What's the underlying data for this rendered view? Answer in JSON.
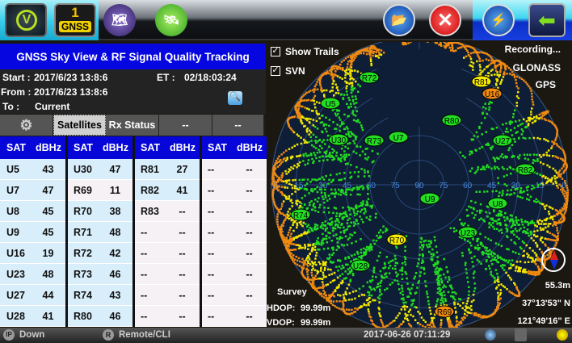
{
  "toolbar": {
    "gnss_count": "1",
    "gnss_label": "GNSS",
    "icons": [
      "viavi-home-icon",
      "gnss-badge-icon",
      "map-lock-icon",
      "satellite-lock-icon",
      "folder-usb-icon",
      "close-icon",
      "power-plug-icon",
      "back-arrow-icon"
    ]
  },
  "title": "GNSS Sky View & RF Signal Quality Tracking",
  "info": {
    "start_label": "Start :",
    "start": "2017/6/23 13:8:6",
    "et_label": "ET :",
    "et": "02/18:03:24",
    "from_label": "From :",
    "from": "2017/6/23 13:8:6",
    "to_label": "To :",
    "to": "Current"
  },
  "tabs": [
    {
      "label": "Satellites",
      "active": true
    },
    {
      "label": "Rx Status"
    },
    {
      "label": "--"
    },
    {
      "label": "--"
    }
  ],
  "table": {
    "headers": [
      "SAT",
      "dBHz"
    ],
    "groups": [
      [
        [
          "U5",
          "43",
          1
        ],
        [
          "U7",
          "47",
          1
        ],
        [
          "U8",
          "45",
          1
        ],
        [
          "U9",
          "45",
          1
        ],
        [
          "U16",
          "19",
          1
        ],
        [
          "U23",
          "48",
          1
        ],
        [
          "U27",
          "44",
          1
        ],
        [
          "U28",
          "41",
          1
        ]
      ],
      [
        [
          "U30",
          "47",
          1
        ],
        [
          "R69",
          "11",
          0
        ],
        [
          "R70",
          "38",
          1
        ],
        [
          "R71",
          "48",
          1
        ],
        [
          "R72",
          "42",
          1
        ],
        [
          "R73",
          "46",
          1
        ],
        [
          "R74",
          "43",
          1
        ],
        [
          "R80",
          "46",
          1
        ]
      ],
      [
        [
          "R81",
          "27",
          1
        ],
        [
          "R82",
          "41",
          1
        ],
        [
          "R83",
          "--",
          0
        ],
        [
          "--",
          "--",
          0
        ],
        [
          "--",
          "--",
          0
        ],
        [
          "--",
          "--",
          0
        ],
        [
          "--",
          "--",
          0
        ],
        [
          "--",
          "--",
          0
        ]
      ],
      [
        [
          "--",
          "--",
          0
        ],
        [
          "--",
          "--",
          0
        ],
        [
          "--",
          "--",
          0
        ],
        [
          "--",
          "--",
          0
        ],
        [
          "--",
          "--",
          0
        ],
        [
          "--",
          "--",
          0
        ],
        [
          "--",
          "--",
          0
        ],
        [
          "--",
          "--",
          0
        ]
      ]
    ]
  },
  "skyview": {
    "show_trails": {
      "label": "Show Trails",
      "checked": true
    },
    "svn": {
      "label": "SVN",
      "checked": true
    },
    "recording": "Recording...",
    "constellations": [
      "GLONASS",
      "GPS"
    ],
    "elevation_ticks": [
      "0",
      "15",
      "30",
      "45",
      "60",
      "75",
      "90",
      "75",
      "60",
      "45",
      "30",
      "15",
      "0"
    ],
    "satellites": [
      {
        "id": "R72",
        "color": "#22dd22"
      },
      {
        "id": "R81",
        "color": "#f4e800"
      },
      {
        "id": "U16",
        "color": "#f08a10"
      },
      {
        "id": "U5",
        "color": "#22dd22"
      },
      {
        "id": "R80",
        "color": "#22dd22"
      },
      {
        "id": "U7",
        "color": "#22dd22"
      },
      {
        "id": "U27",
        "color": "#22dd22"
      },
      {
        "id": "U30",
        "color": "#22dd22"
      },
      {
        "id": "R73",
        "color": "#22dd22"
      },
      {
        "id": "R82",
        "color": "#22dd22"
      },
      {
        "id": "U9",
        "color": "#22dd22"
      },
      {
        "id": "U8",
        "color": "#22dd22"
      },
      {
        "id": "R74",
        "color": "#22dd22"
      },
      {
        "id": "R70",
        "color": "#f4e800"
      },
      {
        "id": "U23",
        "color": "#22dd22"
      },
      {
        "id": "U28",
        "color": "#22dd22"
      },
      {
        "id": "R69",
        "color": "#f08a10"
      }
    ],
    "survey": "Survey",
    "hdop_label": "HDOP:",
    "hdop": "99.99m",
    "vdop_label": "VDOP:",
    "vdop": "99.99m",
    "altitude": "55.3m",
    "latitude": "37°13'53\" N",
    "longitude": "121°49'16\" E"
  },
  "status": {
    "ip_label": "Down",
    "remote_label": "Remote/CLI",
    "datetime": "2017-06-26  07:11:29"
  }
}
